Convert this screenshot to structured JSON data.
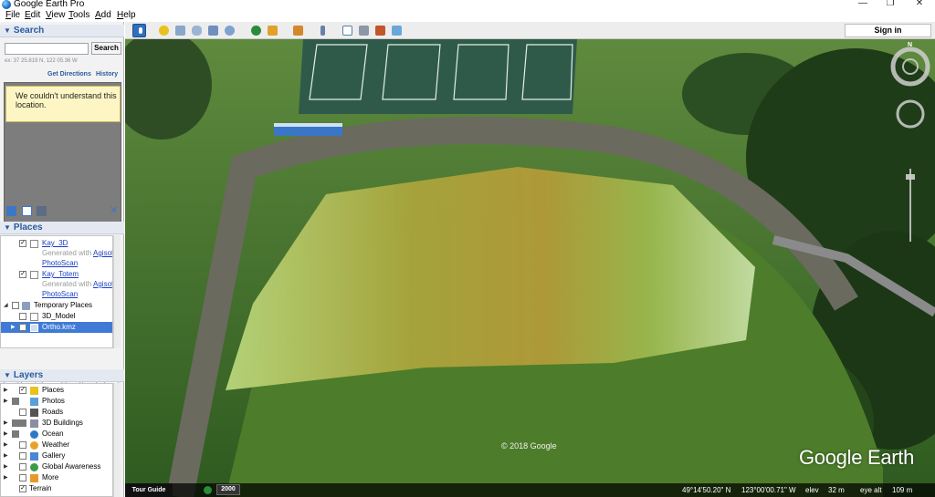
{
  "window": {
    "title": "Google Earth Pro",
    "minimize": "—",
    "restore": "❐",
    "close": "✕"
  },
  "menu": [
    "File",
    "Edit",
    "View",
    "Tools",
    "Add",
    "Help"
  ],
  "toolbar": {
    "signin_label": "Sign in"
  },
  "search": {
    "header": "Search",
    "button_label": "Search",
    "input_value": "",
    "coord_hint": "ex: 37 25.819 N, 122 05.36 W",
    "get_directions": "Get Directions",
    "history": "History",
    "message": "We couldn't understand this location."
  },
  "places": {
    "header": "Places",
    "kay3d": {
      "name": "Kay_3D",
      "gen": "Generated with ",
      "gen_link": "Agisof",
      "link2": "PhotoScan"
    },
    "kaytotem": {
      "name": "Kay_Totem",
      "gen": "Generated with ",
      "gen_link": "Agisof",
      "link2": "PhotoScan"
    },
    "temporary": "Temporary Places",
    "model": "3D_Model",
    "ortho": "Ortho.kmz"
  },
  "layers": {
    "header": "Layers",
    "items": [
      "Places",
      "Photos",
      "Roads",
      "3D Buildings",
      "Ocean",
      "Weather",
      "Gallery",
      "Global Awareness",
      "More",
      "Terrain"
    ]
  },
  "map": {
    "copyright": "© 2018 Google",
    "brand": "Google Earth",
    "compass_n": "N"
  },
  "status": {
    "tour_guide": "Tour Guide",
    "year": "2000",
    "lat": "49°14'50.20\" N",
    "lon": "123°00'00.71\" W",
    "elev_label": "elev",
    "elev_value": "32 m",
    "eye_label": "eye alt",
    "eye_value": "109 m"
  },
  "colors": {
    "accent": "#2a5a9e",
    "selection": "#3f7bd6",
    "link": "#1a3fc4"
  }
}
